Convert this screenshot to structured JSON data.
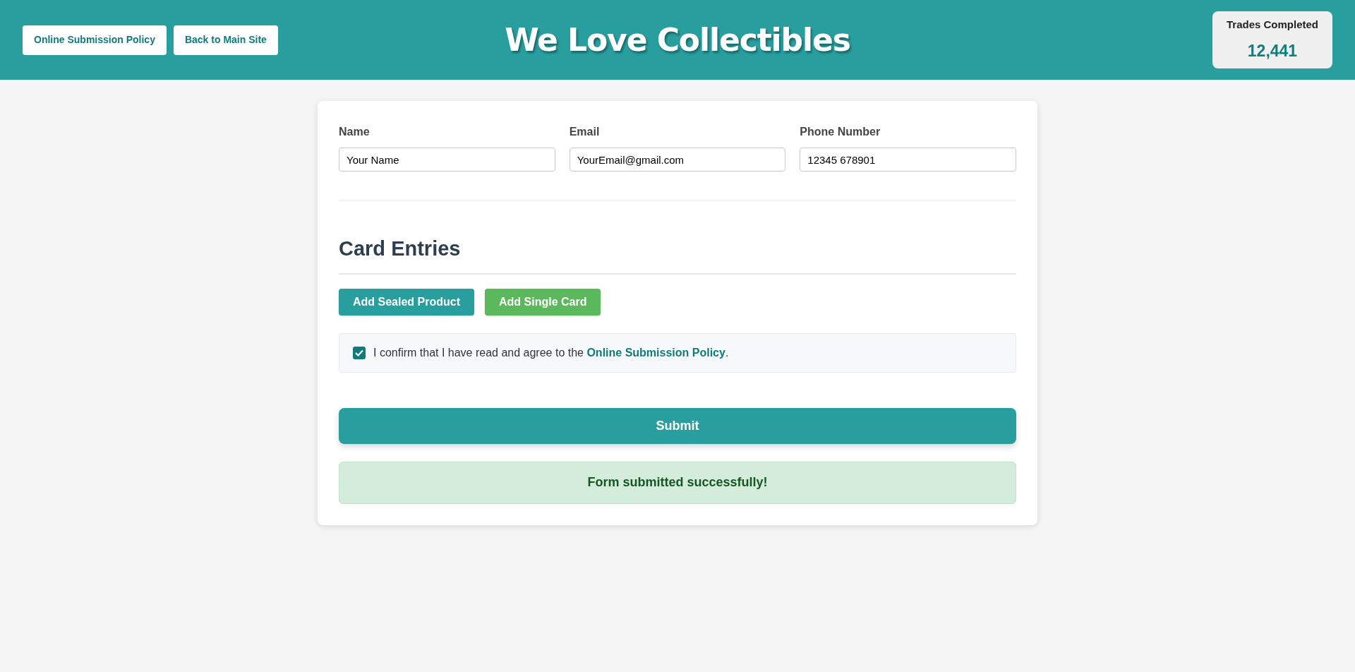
{
  "header": {
    "links": [
      "Online Submission Policy",
      "Back to Main Site"
    ],
    "title": "We Love Collectibles",
    "stat": {
      "label": "Trades Completed",
      "value": "12,441"
    }
  },
  "form": {
    "fields": [
      {
        "label": "Name",
        "value": "Your Name"
      },
      {
        "label": "Email",
        "value": "YourEmail@gmail.com"
      },
      {
        "label": "Phone Number",
        "value": "12345 678901"
      }
    ],
    "section_title": "Card Entries",
    "add_buttons": [
      {
        "label": "Add Sealed Product",
        "kind": "sealed"
      },
      {
        "label": "Add Single Card",
        "kind": "single"
      }
    ],
    "agreement": {
      "checked": true,
      "text": "I confirm that I have read and agree to the ",
      "link": "Online Submission Policy",
      "text_after": "."
    },
    "submit": "Submit",
    "success_message": "Form submitted successfully!"
  }
}
